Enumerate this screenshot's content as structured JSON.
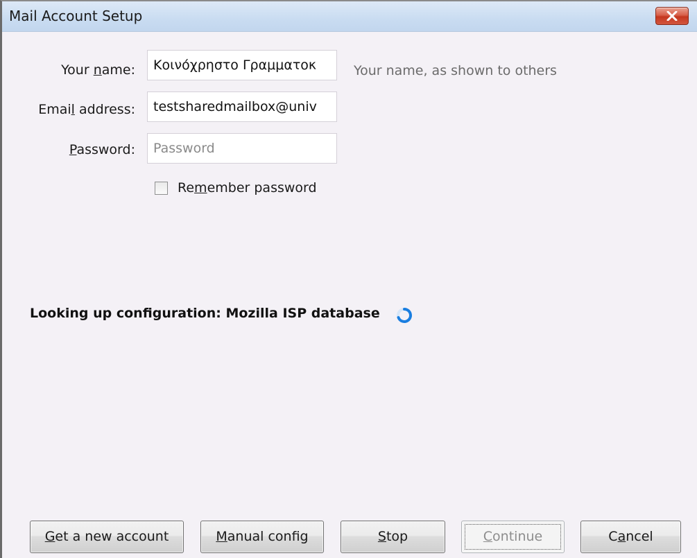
{
  "window": {
    "title": "Mail Account Setup"
  },
  "form": {
    "name_label_pre": "Your ",
    "name_label_acc": "n",
    "name_label_post": "ame:",
    "name_value": "Κοινόχρηστο Γραμματοκ",
    "name_hint": "Your name, as shown to others",
    "email_label_pre": "Emai",
    "email_label_acc": "l",
    "email_label_post": " address:",
    "email_value": "testsharedmailbox@univ",
    "password_label_pre": "",
    "password_label_acc": "P",
    "password_label_post": "assword:",
    "password_placeholder": "Password",
    "remember_pre": "Re",
    "remember_acc": "m",
    "remember_post": "ember password",
    "remember_checked": false
  },
  "status": {
    "text": "Looking up configuration: Mozilla ISP database",
    "spinner_icon": "loading-spinner-icon"
  },
  "buttons": {
    "get_new_acc": "G",
    "get_new_post": "et a new account",
    "manual_acc": "M",
    "manual_post": "anual config",
    "stop_acc": "S",
    "stop_post": "top",
    "continue_acc": "C",
    "continue_post": "ontinue",
    "cancel_pre": "C",
    "cancel_acc": "a",
    "cancel_post": "ncel"
  },
  "colors": {
    "titlebar": "#c9dcf1",
    "background": "#f4f1f6",
    "close_button": "#c5371f",
    "spinner": "#1a7ee0"
  }
}
